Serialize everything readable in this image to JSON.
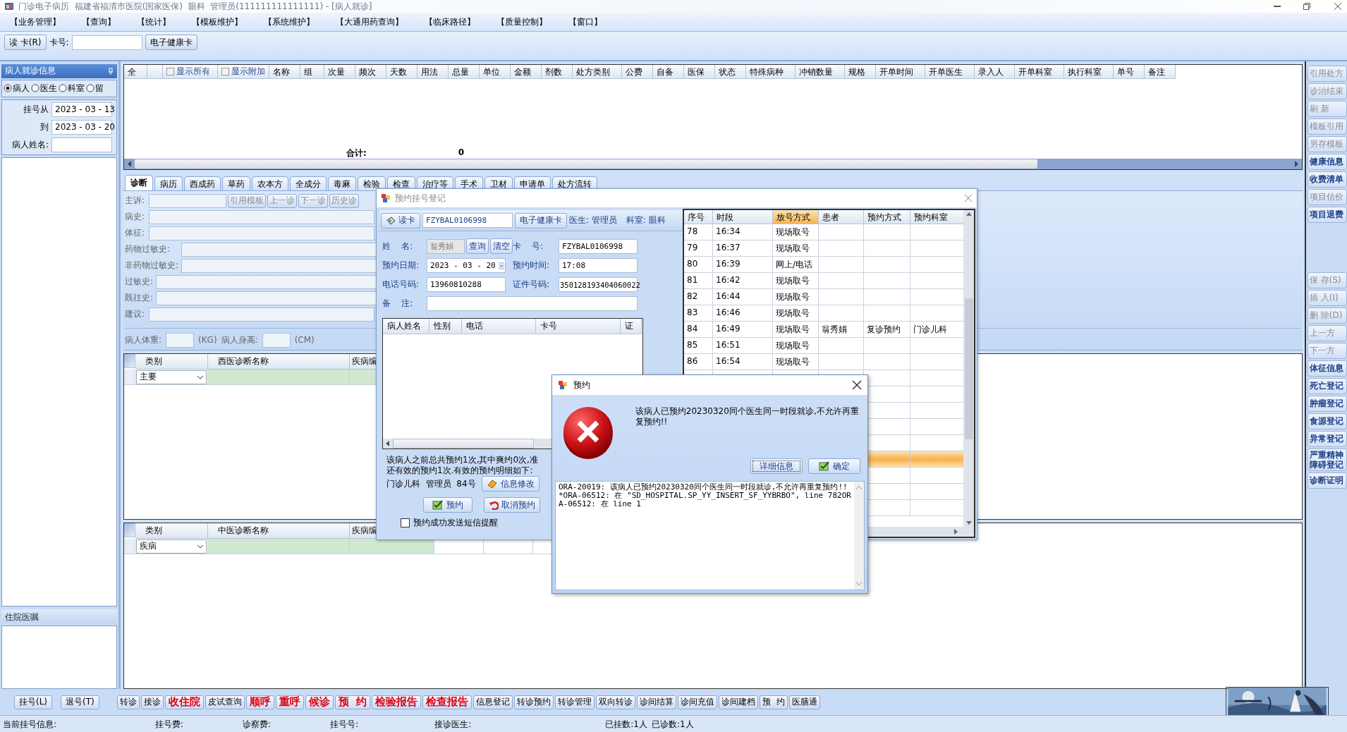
{
  "window": {
    "title": "门诊电子病历  福建省福清市医院(国家医保)  眼科  管理员(111111111111111) - [病人就诊]"
  },
  "menu": [
    "【业务管理】",
    "【查询】",
    "【统计】",
    "【模板维护】",
    "【系统维护】",
    "【大通用药查询】",
    "【临床路径】",
    "【质量控制】",
    "【窗口】"
  ],
  "toolbar": {
    "read_card": "读 卡(R)",
    "card_label": "卡号:",
    "health_card": "电子健康卡"
  },
  "left_panel": {
    "title": "病人就诊信息",
    "filters": [
      {
        "label": "病人",
        "selected": true
      },
      {
        "label": "医生",
        "selected": false
      },
      {
        "label": "科室",
        "selected": false
      },
      {
        "label": "留",
        "selected": false
      }
    ],
    "date_from": {
      "label": "挂号从",
      "value": "2023 - 03 - 13"
    },
    "date_to": {
      "label": "到",
      "value": "2023 - 03 - 20"
    },
    "name_label": "病人姓名:",
    "ward_title": "住院医嘱"
  },
  "prescription_table": {
    "first_column": "全",
    "options": [
      {
        "label": "显示所有",
        "checked": false
      },
      {
        "label": "显示附加",
        "checked": false
      }
    ],
    "columns": [
      "名称",
      "组",
      "次量",
      "频次",
      "天数",
      "用法",
      "总量",
      "单位",
      "金额",
      "剂数",
      "处方类别",
      "公费",
      "自备",
      "医保",
      "状态",
      "特殊病种",
      "冲销数量",
      "规格",
      "开单时间",
      "开单医生",
      "录入人",
      "开单科室",
      "执行科室",
      "单号",
      "备注"
    ],
    "total_label": "合计:",
    "total_value": "0"
  },
  "tabs": [
    {
      "label": "诊断",
      "selected": true
    },
    {
      "label": "病历",
      "selected": false
    },
    {
      "label": "西成药",
      "selected": false
    },
    {
      "label": "草药",
      "selected": false
    },
    {
      "label": "农本方",
      "selected": false
    },
    {
      "label": "全成分",
      "selected": false
    },
    {
      "label": "毒麻",
      "selected": false
    },
    {
      "label": "检验",
      "selected": false
    },
    {
      "label": "检查",
      "selected": false
    },
    {
      "label": "治疗等",
      "selected": false
    },
    {
      "label": "手术",
      "selected": false
    },
    {
      "label": "卫材",
      "selected": false
    },
    {
      "label": "申请单",
      "selected": false
    },
    {
      "label": "处方流转",
      "selected": false
    }
  ],
  "diagnosis_form": {
    "fields": [
      "主诉:",
      "病史:",
      "体征:",
      "药物过敏史:",
      "非药物过敏史:",
      "过敏史:",
      "既往史:",
      "建议:"
    ],
    "buttons": [
      "引用模板",
      "上一诊",
      "下一诊",
      "历史诊"
    ],
    "weight_label": "病人体重:",
    "weight_unit": "(KG)",
    "height_label": "病人身高:",
    "height_unit": "(CM)"
  },
  "western_diagnosis": {
    "columns": [
      "类别",
      "西医诊断名称",
      "疾病编"
    ],
    "rows": [
      {
        "category": "主要"
      }
    ]
  },
  "chinese_diagnosis": {
    "columns": [
      "类别",
      "中医诊断名称",
      "疾病编"
    ],
    "rows": [
      {
        "category": "疾病"
      }
    ]
  },
  "side_buttons_top": [
    {
      "label": "引用处方",
      "disabled": true
    },
    {
      "label": "诊治结束",
      "disabled": true
    },
    {
      "label": "刷 新",
      "disabled": true
    },
    {
      "label": "模板引用",
      "disabled": true
    },
    {
      "label": "另存模板",
      "disabled": true
    },
    {
      "label": "健康信息",
      "disabled": false
    },
    {
      "label": "收费清单",
      "disabled": false
    },
    {
      "label": "项目估价",
      "disabled": true
    },
    {
      "label": "项目退费",
      "disabled": false
    }
  ],
  "side_buttons_bottom": [
    {
      "label": "保 存(S)",
      "disabled": true
    },
    {
      "label": "插 入(I)",
      "disabled": true
    },
    {
      "label": "删 除(D)",
      "disabled": true
    },
    {
      "label": "上一方",
      "disabled": true
    },
    {
      "label": "下一方",
      "disabled": true
    },
    {
      "label": "体征信息",
      "disabled": false
    },
    {
      "label": "死亡登记",
      "disabled": false
    },
    {
      "label": "肿瘤登记",
      "disabled": false
    },
    {
      "label": "食源登记",
      "disabled": false
    },
    {
      "label": "异常登记",
      "disabled": false
    },
    {
      "label": "严重精神障碍登记",
      "disabled": false
    },
    {
      "label": "诊断证明",
      "disabled": false
    }
  ],
  "register_buttons": [
    "挂号(L)",
    "退号(T)"
  ],
  "bottom_buttons": [
    {
      "label": "转诊",
      "kind": "normal"
    },
    {
      "label": "接诊",
      "kind": "normal"
    },
    {
      "label": "收住院",
      "kind": "alert"
    },
    {
      "label": "皮试查询",
      "kind": "normal"
    },
    {
      "label": "顺呼",
      "kind": "alert"
    },
    {
      "label": "重呼",
      "kind": "alert"
    },
    {
      "label": "候诊",
      "kind": "alert"
    },
    {
      "label": "预  约",
      "kind": "alert"
    },
    {
      "label": "检验报告",
      "kind": "alert"
    },
    {
      "label": "检查报告",
      "kind": "alert"
    },
    {
      "label": "信息登记",
      "kind": "normal"
    },
    {
      "label": "转诊预约",
      "kind": "normal"
    },
    {
      "label": "转诊管理",
      "kind": "normal"
    },
    {
      "label": "双向转诊",
      "kind": "normal"
    },
    {
      "label": "诊间结算",
      "kind": "normal"
    },
    {
      "label": "诊间充值",
      "kind": "normal"
    },
    {
      "label": "诊间建档",
      "kind": "normal"
    },
    {
      "label": "预  约",
      "kind": "normal"
    },
    {
      "label": "医膳通",
      "kind": "normal"
    }
  ],
  "logo": {
    "kind": "picture"
  },
  "status_bar": [
    "当前挂号信息:",
    "挂号费:",
    "诊察费:",
    "挂号号:",
    "接诊医生:",
    "已挂数:1人",
    "已诊数:1人"
  ],
  "booking_dialog": {
    "title": "预约挂号登记",
    "read_card": "读卡",
    "card_value": "FZYBAL0106998",
    "health_card": "电子健康卡",
    "doctor": "医生: 管理员",
    "department": "科室: 眼科",
    "name": {
      "label": "姓    名:",
      "value": "翁秀娟"
    },
    "query": "查询",
    "clear": "清空",
    "card_no": {
      "label": "卡    号:",
      "value": "FZYBAL0106998"
    },
    "date": {
      "label": "预约日期:",
      "value": "2023 - 03 - 20"
    },
    "time": {
      "label": "预约时间:",
      "value": "17:08"
    },
    "phone": {
      "label": "电话号码:",
      "value": "13960810288"
    },
    "id_no": {
      "label": "证件号码:",
      "value": "350128193404060022"
    },
    "note": {
      "label": "备    注:"
    },
    "patient_columns": [
      "病人姓名",
      "性别",
      "电话",
      "卡号",
      "证"
    ],
    "summary": [
      "该病人之前总共预约1次,其中爽约0次,准",
      "还有效的预约1次.有效的预约明细如下:",
      "门诊儿科  管理员  84号"
    ],
    "edit_info": "信息修改",
    "book": "预约",
    "cancel": "取消预约",
    "sms": {
      "label": "预约成功发送短信提醒",
      "checked": false
    },
    "slot_columns": [
      {
        "label": "序号",
        "selected": false
      },
      {
        "label": "时段",
        "selected": false
      },
      {
        "label": "放号方式",
        "selected": true
      },
      {
        "label": "患者",
        "selected": false
      },
      {
        "label": "预约方式",
        "selected": false
      },
      {
        "label": "预约科室",
        "selected": false
      }
    ],
    "slots": [
      {
        "cells": [
          "78",
          "16:34",
          "现场取号"
        ],
        "selected": false
      },
      {
        "cells": [
          "79",
          "16:37",
          "现场取号"
        ],
        "selected": false
      },
      {
        "cells": [
          "80",
          "16:39",
          "网上/电话"
        ],
        "selected": false
      },
      {
        "cells": [
          "81",
          "16:42",
          "现场取号"
        ],
        "selected": false
      },
      {
        "cells": [
          "82",
          "16:44",
          "现场取号"
        ],
        "selected": false
      },
      {
        "cells": [
          "83",
          "16:46",
          "现场取号"
        ],
        "selected": false
      },
      {
        "cells": [
          "84",
          "16:49",
          "现场取号",
          "翁秀娟",
          "复诊预约",
          "门诊儿科"
        ],
        "selected": false
      },
      {
        "cells": [
          "85",
          "16:51",
          "现场取号"
        ],
        "selected": false
      },
      {
        "cells": [
          "86",
          "16:54",
          "现场取号"
        ],
        "selected": false
      },
      {
        "selected": false
      },
      {
        "selected": false
      },
      {
        "selected": false
      },
      {
        "selected": false
      },
      {
        "selected": false
      },
      {
        "selected": true
      },
      {
        "selected": false
      },
      {
        "selected": false
      },
      {
        "selected": false
      }
    ]
  },
  "error_dialog": {
    "title": "预约",
    "message": "该病人已预约20230320同个医生同一时段就诊,不允许再重复预约!!",
    "details_button": "详细信息",
    "ok_button": "确定",
    "details": "ORA-20019: 该病人已预约20230320同个医生同一时段就诊,不允许再重复预约!! *ORA-06512: 在 \"SD_HOSPITAL.SP_YY_INSERT_SF_YYBRBO\", line 782ORA-06512: 在 line 1"
  }
}
